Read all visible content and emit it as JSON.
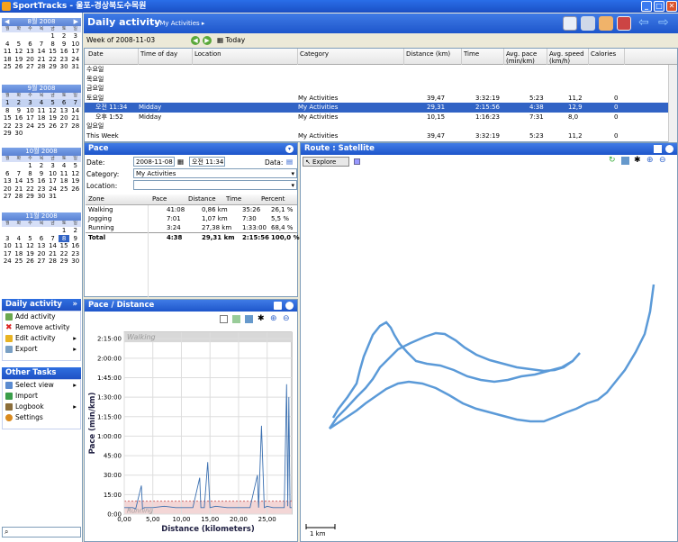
{
  "app": {
    "title": "SportTracks - 울포-경상북도수목원"
  },
  "calendars": [
    {
      "title": "8월 2008",
      "dow": [
        "월",
        "화",
        "수",
        "목",
        "금",
        "토",
        "일"
      ],
      "days": [
        "",
        "",
        "",
        "",
        "1",
        "2",
        "3",
        "4",
        "5",
        "6",
        "7",
        "8",
        "9",
        "10",
        "11",
        "12",
        "13",
        "14",
        "15",
        "16",
        "17",
        "18",
        "19",
        "20",
        "21",
        "22",
        "23",
        "24",
        "25",
        "26",
        "27",
        "28",
        "29",
        "30",
        "31"
      ]
    },
    {
      "title": "9월 2008",
      "dow": [
        "월",
        "화",
        "수",
        "목",
        "금",
        "토",
        "일"
      ],
      "days": [
        "1",
        "2",
        "3",
        "4",
        "5",
        "6",
        "7",
        "8",
        "9",
        "10",
        "11",
        "12",
        "13",
        "14",
        "15",
        "16",
        "17",
        "18",
        "19",
        "20",
        "21",
        "22",
        "23",
        "24",
        "25",
        "26",
        "27",
        "28",
        "29",
        "30"
      ]
    },
    {
      "title": "10월 2008",
      "dow": [
        "월",
        "화",
        "수",
        "목",
        "금",
        "토",
        "일"
      ],
      "days": [
        "",
        "",
        "1",
        "2",
        "3",
        "4",
        "5",
        "6",
        "7",
        "8",
        "9",
        "10",
        "11",
        "12",
        "13",
        "14",
        "15",
        "16",
        "17",
        "18",
        "19",
        "20",
        "21",
        "22",
        "23",
        "24",
        "25",
        "26",
        "27",
        "28",
        "29",
        "30",
        "31"
      ]
    },
    {
      "title": "11월 2008",
      "dow": [
        "월",
        "화",
        "수",
        "목",
        "금",
        "토",
        "일"
      ],
      "days": [
        "",
        "",
        "",
        "",
        "",
        "1",
        "2",
        "3",
        "4",
        "5",
        "6",
        "7",
        "8",
        "9",
        "10",
        "11",
        "12",
        "13",
        "14",
        "15",
        "16",
        "17",
        "18",
        "19",
        "20",
        "21",
        "22",
        "23",
        "24",
        "25",
        "26",
        "27",
        "28",
        "29",
        "30"
      ]
    }
  ],
  "tasks": {
    "title": "Daily activity",
    "items": [
      "Add activity",
      "Remove activity",
      "Edit activity",
      "Export"
    ]
  },
  "other": {
    "title": "Other Tasks",
    "items": [
      "Select view",
      "Import",
      "Logbook",
      "Settings"
    ]
  },
  "main": {
    "title": "Daily activity",
    "breadcrumb": "My Activities",
    "week": "Week of 2008-11-03",
    "today": "Today"
  },
  "grid": {
    "headers": [
      "Date",
      "Time of day",
      "Location",
      "Category",
      "Distance (km)",
      "Time",
      "Avg. pace (min/km)",
      "Avg. speed (km/h)",
      "Calories"
    ],
    "rows": [
      {
        "date": "수요일"
      },
      {
        "date": "목요일"
      },
      {
        "date": "금요일"
      },
      {
        "date": "토요일",
        "cat": "My Activities",
        "dist": "39,47",
        "time": "3:32:19",
        "pace": "5:23",
        "speed": "11,2",
        "cal": "0"
      },
      {
        "date": "오전 11:34",
        "tod": "Midday",
        "cat": "My Activities",
        "dist": "29,31",
        "time": "2:15:56",
        "pace": "4:38",
        "speed": "12,9",
        "cal": "0",
        "sel": true
      },
      {
        "date": "오후 1:52",
        "tod": "Midday",
        "cat": "My Activities",
        "dist": "10,15",
        "time": "1:16:23",
        "pace": "7:31",
        "speed": "8,0",
        "cal": "0"
      },
      {
        "date": "일요일"
      },
      {
        "date": "This Week",
        "cat": "My Activities",
        "dist": "39,47",
        "time": "3:32:19",
        "pace": "5:23",
        "speed": "11,2",
        "cal": "0"
      }
    ]
  },
  "pace": {
    "title": "Pace",
    "date_label": "Date:",
    "date": "2008-11-08",
    "time": "오전 11:34",
    "data_label": "Data:",
    "category_label": "Category:",
    "category": "My Activities",
    "location_label": "Location:",
    "zheaders": [
      "Zone",
      "Pace",
      "Distance",
      "Time",
      "Percent"
    ],
    "zones": [
      [
        "Walking",
        "41:08",
        "0,86 km",
        "35:26",
        "26,1 %"
      ],
      [
        "Jogging",
        "7:01",
        "1,07 km",
        "7:30",
        "5,5 %"
      ],
      [
        "Running",
        "3:24",
        "27,38 km",
        "1:33:00",
        "68,4 %"
      ]
    ],
    "total": [
      "Total",
      "4:38",
      "29,31 km",
      "2:15:56",
      "100,0 %"
    ]
  },
  "chart_data": {
    "type": "line",
    "title": "Pace / Distance",
    "xlabel": "Distance (kilometers)",
    "ylabel": "Pace (min/km)",
    "xticks": [
      "0,00",
      "5,00",
      "10,00",
      "15,00",
      "20,00",
      "25,00"
    ],
    "yticks": [
      "0:00",
      "15:00",
      "30:00",
      "45:00",
      "1:00:00",
      "1:15:00",
      "1:30:00",
      "1:45:00",
      "2:00:00",
      "2:15:00"
    ],
    "xlim": [
      0,
      29.3
    ],
    "ylim": [
      0,
      140
    ],
    "zones": [
      "Walking",
      "Running"
    ],
    "series": [
      {
        "x": [
          0,
          1.5,
          2,
          3,
          3.2,
          3.5,
          5,
          7,
          9,
          10,
          12,
          13.2,
          13.4,
          14,
          14.6,
          15,
          16,
          18,
          20,
          22,
          23.3,
          23.5,
          24,
          24.5,
          25,
          26,
          27,
          28,
          28.4,
          28.6,
          28.8,
          29,
          29.3
        ],
        "y": [
          5,
          5,
          4,
          22,
          4,
          5,
          5,
          6,
          5,
          5,
          5,
          28,
          5,
          5,
          40,
          5,
          6,
          5,
          5,
          5,
          30,
          5,
          68,
          5,
          6,
          5,
          5,
          5,
          100,
          6,
          90,
          5,
          5
        ]
      }
    ]
  },
  "route": {
    "title": "Route : Satellite",
    "explore": "Explore",
    "scale": "1 km"
  }
}
